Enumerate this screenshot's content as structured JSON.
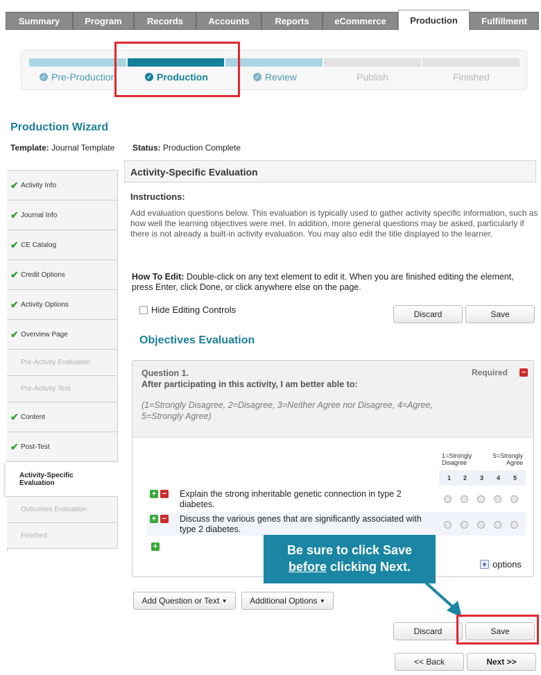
{
  "tabs": [
    "Summary",
    "Program",
    "Records",
    "Accounts",
    "Reports",
    "eCommerce",
    "Production",
    "Fulfillment"
  ],
  "active_tab": "Production",
  "stepper": {
    "steps": [
      "Pre-Production",
      "Production",
      "Review",
      "Publish",
      "Finished"
    ]
  },
  "wizard": {
    "title": "Production Wizard",
    "template_label": "Template:",
    "template_value": "Journal Template",
    "status_label": "Status:",
    "status_value": "Production Complete"
  },
  "sidebar": {
    "items": [
      {
        "label": "Activity Info",
        "checked": true
      },
      {
        "label": "Journal Info",
        "checked": true
      },
      {
        "label": "CE Catalog",
        "checked": true
      },
      {
        "label": "Credit Options",
        "checked": true
      },
      {
        "label": "Activity Options",
        "checked": true
      },
      {
        "label": "Overview Page",
        "checked": true
      },
      {
        "label": "Pre-Activity Evaluation",
        "checked": false
      },
      {
        "label": "Pre-Activity Test",
        "checked": false
      },
      {
        "label": "Content",
        "checked": true
      },
      {
        "label": "Post-Test",
        "checked": true
      },
      {
        "label": "Activity-Specific Evaluation",
        "checked": false
      },
      {
        "label": "Outcomes Evaluation",
        "checked": false
      },
      {
        "label": "Finished",
        "checked": false
      }
    ]
  },
  "main": {
    "section_title": "Activity-Specific Evaluation",
    "instructions_label": "Instructions:",
    "instructions_text": "Add evaluation questions below. This evaluation is typically used to gather activity specific information, such as how well the learning objectives were met. In addition, more general questions may be asked, particularly if there is not already a built-in activity evaluation. You may also edit the title displayed to the learner.",
    "howto_label": "How To Edit:",
    "howto_text": "Double-click on any text element to edit it. When you are finished editing the element, press Enter, click Done, or click anywhere else on the page.",
    "hide_controls_label": "Hide Editing Controls",
    "discard_label": "Discard",
    "save_label": "Save",
    "eval_title": "Objectives Evaluation",
    "question": {
      "number": "Question 1.",
      "text": "After participating in this activity, I am better able to:",
      "required": "Required",
      "scale": "(1=Strongly Disagree, 2=Disagree, 3=Neither Agree nor Disagree, 4=Agree, 5=Strongly Agree)",
      "scale_low": "1=Strongly Disagree",
      "scale_high": "5=Strongly Agree",
      "scale_nums": [
        "1",
        "2",
        "3",
        "4",
        "5"
      ],
      "rows": [
        "Explain the strong inheritable genetic connection in type 2 diabetes.",
        "Discuss the various genes that are significantly associated with type 2 diabetes."
      ],
      "options_label": "options"
    },
    "add_question_label": "Add Question or Text",
    "additional_options_label": "Additional Options",
    "back_label": "<< Back",
    "next_label": "Next >>"
  },
  "callout": {
    "line1": "Be sure to click Save",
    "line2_u": "before",
    "line2_rest": " clicking Next."
  },
  "colors": {
    "accent": "#1b7f99",
    "callout": "#1a86a3",
    "highlight": "#e0282e"
  }
}
